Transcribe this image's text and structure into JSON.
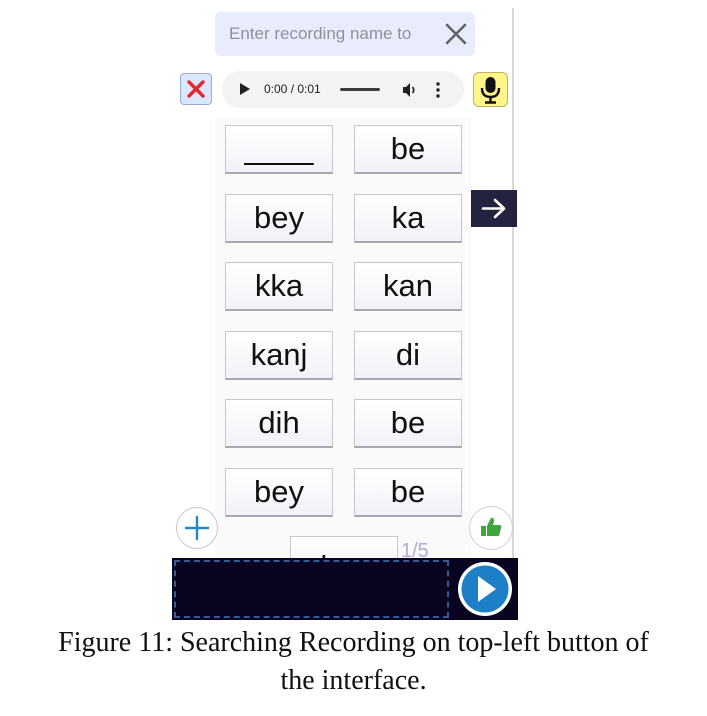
{
  "search": {
    "placeholder": "Enter recording name to"
  },
  "audio_player": {
    "time": "0:00 / 0:01"
  },
  "word_grid": [
    [
      "____",
      "be"
    ],
    [
      "bey",
      "ka"
    ],
    [
      "kka",
      "kan"
    ],
    [
      "kanj",
      "di"
    ],
    [
      "dih",
      "be"
    ],
    [
      "bey",
      "be"
    ]
  ],
  "partial_word": "bey",
  "page_indicator": "1/5",
  "caption": [
    "Figure 11: Searching Recording on top-left button of",
    "the interface."
  ],
  "colors": {
    "search_bg": "#e9ecfb",
    "delete_btn_bg": "#dbe6ff",
    "delete_x": "#e8262d",
    "mic_btn_bg": "#fff68a",
    "next_btn_bg": "#24233f",
    "add_icon": "#1e88c9",
    "like_icon": "#3fa63a",
    "bottom_bar_bg": "#0b0420",
    "play_btn": "#1d7fc7"
  },
  "icons": [
    "close-icon",
    "delete-icon",
    "play-icon",
    "volume-icon",
    "more-vert-icon",
    "microphone-icon",
    "arrow-right-icon",
    "plus-icon",
    "thumbs-up-icon",
    "play-circle-icon"
  ]
}
